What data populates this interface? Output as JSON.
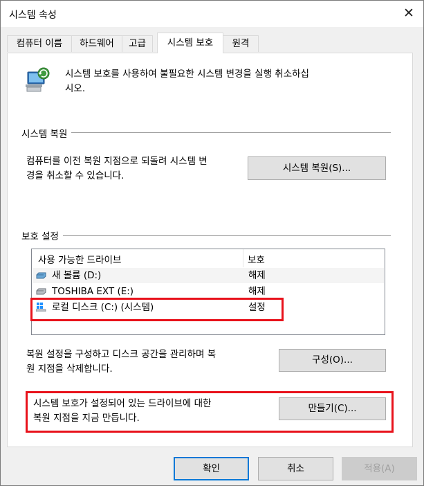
{
  "window": {
    "title": "시스템 속성",
    "close_glyph": "✕"
  },
  "tabs": [
    {
      "label": "컴퓨터 이름"
    },
    {
      "label": "하드웨어"
    },
    {
      "label": "고급"
    },
    {
      "label": "시스템 보호"
    },
    {
      "label": "원격"
    }
  ],
  "intro": {
    "line1": "시스템 보호를 사용하여 불필요한 시스템 변경을 실행 취소하십",
    "line2": "시오."
  },
  "restore": {
    "group_label": "시스템 복원",
    "desc_line1": "컴퓨터를 이전 복원 지점으로 되돌려 시스템 변",
    "desc_line2": "경을 취소할 수 있습니다.",
    "button": "시스템 복원(S)..."
  },
  "protection": {
    "group_label": "보호 설정",
    "columns": [
      "사용 가능한 드라이브",
      "보호"
    ],
    "drives": [
      {
        "name": "새 볼륨 (D:)",
        "protection": "해제",
        "icon": "drive-icon"
      },
      {
        "name": "TOSHIBA EXT (E:)",
        "protection": "해제",
        "icon": "drive-icon"
      },
      {
        "name": "로컬 디스크 (C:) (시스템)",
        "protection": "설정",
        "icon": "windows-drive-icon"
      }
    ],
    "configure_line1": "복원 설정을 구성하고 디스크 공간을 관리하며 복",
    "configure_line2": "원 지점을 삭제합니다.",
    "configure_button": "구성(O)...",
    "create_line1": "시스템 보호가 설정되어 있는 드라이브에 대한",
    "create_line2": "복원 지점을 지금 만듭니다.",
    "create_button": "만들기(C)..."
  },
  "footer": {
    "ok": "확인",
    "cancel": "취소",
    "apply": "적용(A)"
  },
  "colors": {
    "highlight": "#e8121b",
    "focus": "#0078d7"
  }
}
